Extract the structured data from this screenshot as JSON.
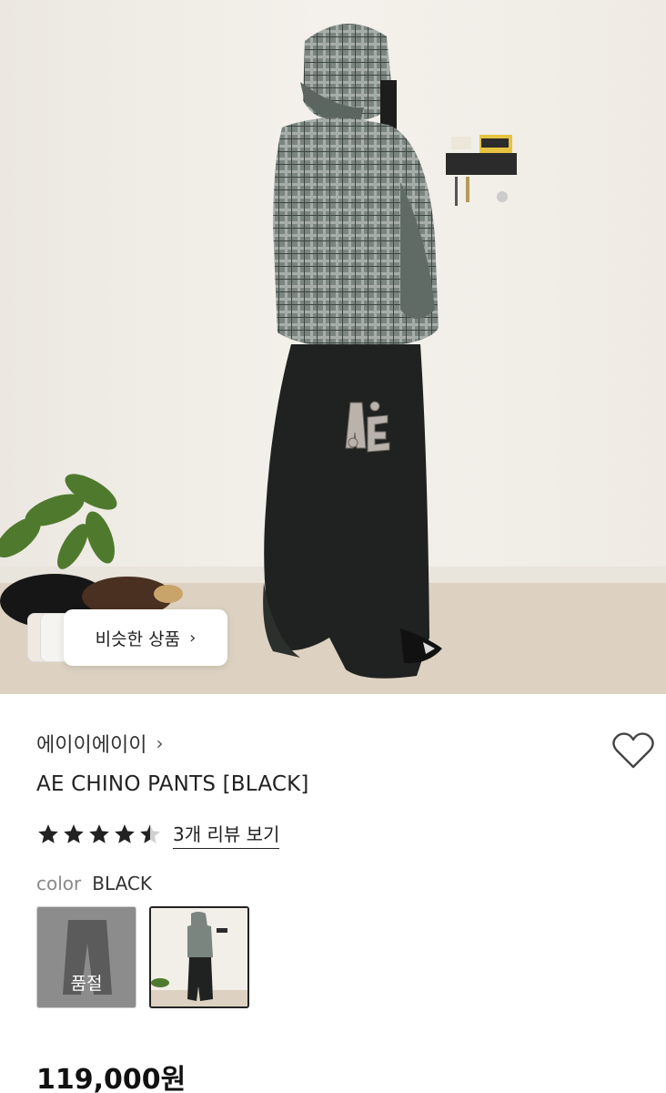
{
  "hero": {
    "image": "person-in-plaid-hoodie-and-black-wide-pants",
    "similar_button_label": "비슷한 상품",
    "similar_chevron": "›"
  },
  "product": {
    "brand": "에이이에이이",
    "brand_chevron": "›",
    "title": "AE CHINO PANTS [BLACK]",
    "rating": 4.5,
    "review_link": "3개 리뷰 보기",
    "color_label": "color",
    "color_value": "BLACK",
    "swatches": [
      {
        "status": "품절"
      },
      {
        "status": ""
      }
    ],
    "price": "119,000원"
  },
  "icons": {
    "heart": "heart-outline-icon",
    "star": "star-icon"
  },
  "colors": {
    "star_fill": "#222222",
    "wall": "#f1ede6",
    "floor": "#ddd2c2"
  }
}
